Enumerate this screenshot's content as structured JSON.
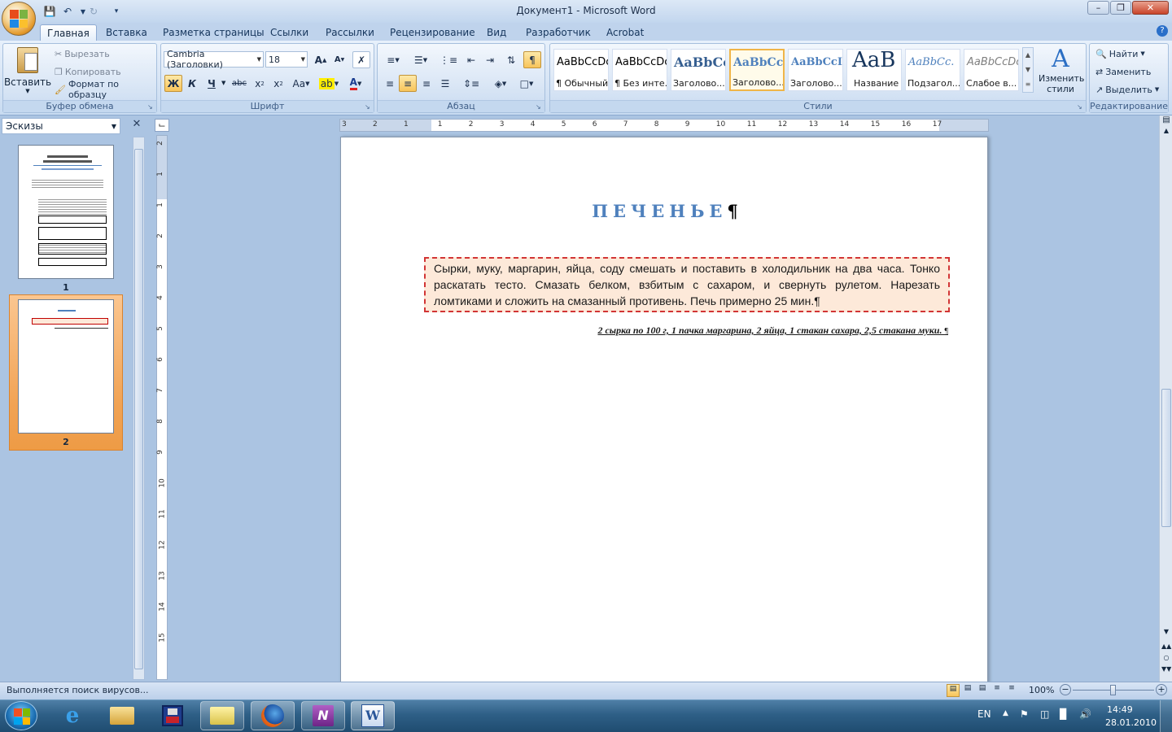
{
  "window": {
    "title": "Документ1 - Microsoft Word"
  },
  "tabs": [
    "Главная",
    "Вставка",
    "Разметка страницы",
    "Ссылки",
    "Рассылки",
    "Рецензирование",
    "Вид",
    "Разработчик",
    "Acrobat"
  ],
  "clipboard": {
    "paste": "Вставить",
    "cut": "Вырезать",
    "copy": "Копировать",
    "format_painter": "Формат по образцу",
    "label": "Буфер обмена"
  },
  "font": {
    "name": "Cambria (Заголовки)",
    "size": "18",
    "label": "Шрифт",
    "bold": "Ж",
    "italic": "К",
    "underline": "Ч"
  },
  "paragraph": {
    "label": "Абзац"
  },
  "styles": {
    "label": "Стили",
    "items": [
      {
        "sample": "AaBbCcDc",
        "name": "¶ Обычный"
      },
      {
        "sample": "AaBbCcDc",
        "name": "¶ Без инте..."
      },
      {
        "sample": "AaBbCc",
        "name": "Заголово..."
      },
      {
        "sample": "AaBbCc",
        "name": "Заголово..."
      },
      {
        "sample": "AaBbCcI",
        "name": "Заголово..."
      },
      {
        "sample": "AaB",
        "name": "Название"
      },
      {
        "sample": "AaBbCc.",
        "name": "Подзагол..."
      },
      {
        "sample": "AaBbCcDc",
        "name": "Слабое в..."
      }
    ],
    "change_styles": "Изменить стили"
  },
  "editing": {
    "find": "Найти",
    "replace": "Заменить",
    "select": "Выделить",
    "label": "Редактирование"
  },
  "nav_pane": {
    "title": "Эскизы",
    "pages": [
      "1",
      "2"
    ]
  },
  "document": {
    "heading": "ПЕЧЕНЬЕ",
    "paragraph": "Сырки, муку, маргарин, яйца, соду смешать и поставить в холодильник на два часа. Тонко раскатать тесто. Смазать белком, взбитым с сахаром, и свернуть рулетом. Нарезать ломтиками и сложить на смазанный противень. Печь примерно 25 мин.",
    "ingredients": "2 сырка по 100 г, 1 пачка маргарина, 2 яйца, 1 стакан сахара, 2,5 стакана муки."
  },
  "ruler": {
    "h_ticks": [
      "3",
      "2",
      "1",
      "1",
      "2",
      "3",
      "4",
      "5",
      "6",
      "7",
      "8",
      "9",
      "10",
      "11",
      "12",
      "13",
      "14",
      "15",
      "16",
      "17"
    ],
    "v_ticks": [
      "2",
      "1",
      "1",
      "2",
      "3",
      "4",
      "5",
      "6",
      "7",
      "8",
      "9",
      "10",
      "11",
      "12",
      "13",
      "14",
      "15"
    ]
  },
  "status": {
    "text": "Выполняется поиск вирусов...",
    "zoom": "100%"
  },
  "taskbar": {
    "lang": "EN",
    "time": "14:49",
    "date": "28.01.2010"
  },
  "colors": {
    "heading": "#4f81bd",
    "selection_fill": "#fde9d9",
    "accent": "#f0b548"
  }
}
